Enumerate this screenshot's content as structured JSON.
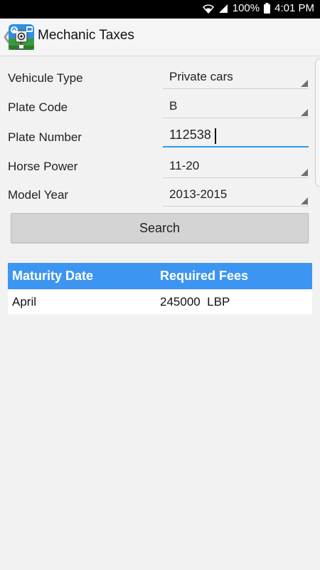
{
  "status_bar": {
    "battery_percent": "100%",
    "time": "4:01 PM",
    "icons": [
      "wifi-icon",
      "signal-icon",
      "battery-icon"
    ]
  },
  "app_bar": {
    "title": "Mechanic Taxes",
    "back_icon": "chevron-left-icon",
    "app_icon": "app-logo-icon"
  },
  "form": {
    "vehicle_type": {
      "label": "Vehicule Type",
      "value": "Private cars"
    },
    "plate_code": {
      "label": "Plate Code",
      "value": "B"
    },
    "plate_number": {
      "label": "Plate Number",
      "value": "112538"
    },
    "horse_power": {
      "label": "Horse Power",
      "value": "11-20"
    },
    "model_year": {
      "label": "Model Year",
      "value": "2013-2015"
    },
    "search_label": "Search"
  },
  "results": {
    "headers": [
      "Maturity Date",
      "Required Fees"
    ],
    "rows": [
      [
        "April",
        "245000  LBP"
      ]
    ]
  },
  "colors": {
    "table_header": "#3d95f2",
    "input_focus_underline": "#2b9de6",
    "status_bar_bg": "#000000",
    "background": "#f2f2f2"
  }
}
